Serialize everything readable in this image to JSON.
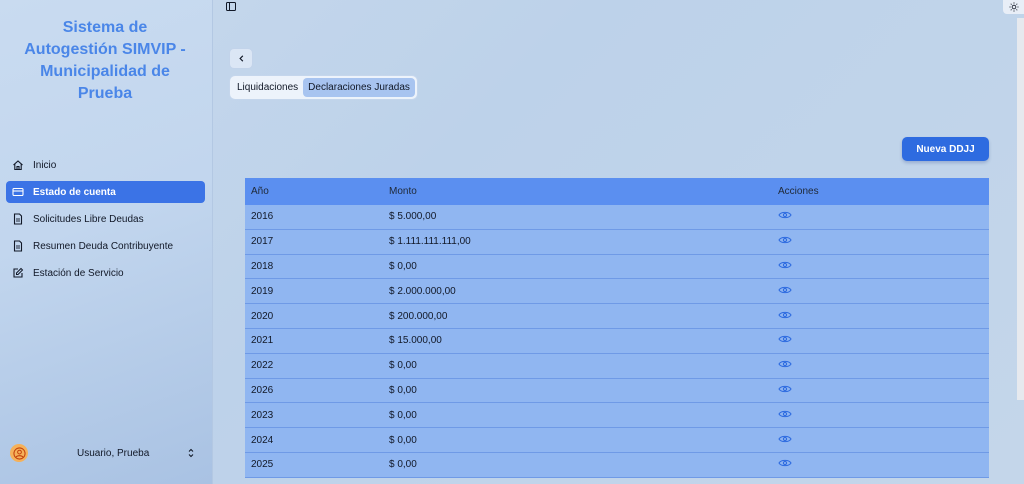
{
  "sidebar": {
    "brand": [
      "Sistema de",
      "Autogestión SIMVIP -",
      "Municipalidad de",
      "Prueba"
    ],
    "items": [
      {
        "label": "Inicio",
        "icon": "home-icon"
      },
      {
        "label": "Estado de cuenta",
        "icon": "card-icon",
        "active": true
      },
      {
        "label": "Solicitudes Libre Deudas",
        "icon": "document-icon"
      },
      {
        "label": "Resumen Deuda Contribuyente",
        "icon": "document-icon"
      },
      {
        "label": "Estación de Servicio",
        "icon": "edit-icon"
      }
    ],
    "user": "Usuario, Prueba"
  },
  "tabs": [
    {
      "label": "Liquidaciones",
      "active": false
    },
    {
      "label": "Declaraciones Juradas",
      "active": true
    }
  ],
  "actions": {
    "new_label": "Nueva DDJJ"
  },
  "table": {
    "headers": [
      "Año",
      "Monto",
      "Acciones"
    ],
    "rows": [
      {
        "year": "2016",
        "amount": "$ 5.000,00"
      },
      {
        "year": "2017",
        "amount": "$ 1.111.111.111,00"
      },
      {
        "year": "2018",
        "amount": "$ 0,00"
      },
      {
        "year": "2019",
        "amount": "$ 2.000.000,00"
      },
      {
        "year": "2020",
        "amount": "$ 200.000,00"
      },
      {
        "year": "2021",
        "amount": "$ 15.000,00"
      },
      {
        "year": "2022",
        "amount": "$ 0,00"
      },
      {
        "year": "2026",
        "amount": "$ 0,00"
      },
      {
        "year": "2023",
        "amount": "$ 0,00"
      },
      {
        "year": "2024",
        "amount": "$ 0,00"
      },
      {
        "year": "2025",
        "amount": "$ 0,00"
      }
    ]
  },
  "colors": {
    "accent": "#3b73e6",
    "brand": "#4a86e8",
    "header": "#5b8ff0",
    "row": "#90b6f1"
  }
}
